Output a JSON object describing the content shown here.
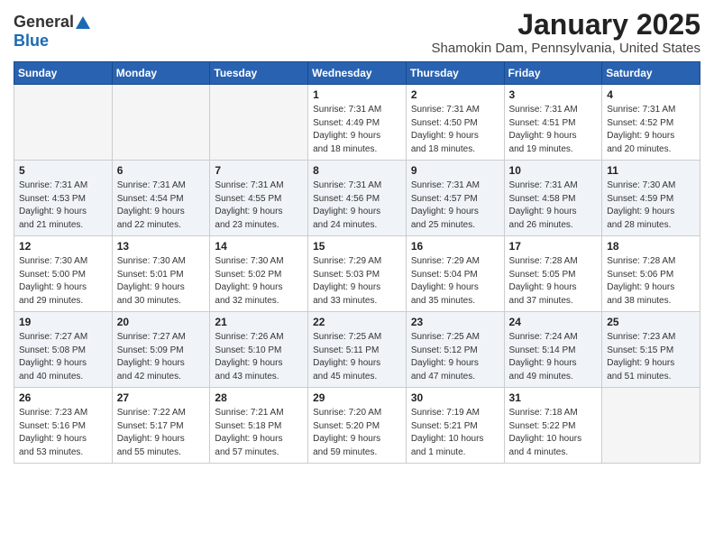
{
  "header": {
    "logo_general": "General",
    "logo_blue": "Blue",
    "month": "January 2025",
    "location": "Shamokin Dam, Pennsylvania, United States"
  },
  "weekdays": [
    "Sunday",
    "Monday",
    "Tuesday",
    "Wednesday",
    "Thursday",
    "Friday",
    "Saturday"
  ],
  "weeks": [
    [
      {
        "day": "",
        "info": "",
        "empty": true
      },
      {
        "day": "",
        "info": "",
        "empty": true
      },
      {
        "day": "",
        "info": "",
        "empty": true
      },
      {
        "day": "1",
        "info": "Sunrise: 7:31 AM\nSunset: 4:49 PM\nDaylight: 9 hours\nand 18 minutes."
      },
      {
        "day": "2",
        "info": "Sunrise: 7:31 AM\nSunset: 4:50 PM\nDaylight: 9 hours\nand 18 minutes."
      },
      {
        "day": "3",
        "info": "Sunrise: 7:31 AM\nSunset: 4:51 PM\nDaylight: 9 hours\nand 19 minutes."
      },
      {
        "day": "4",
        "info": "Sunrise: 7:31 AM\nSunset: 4:52 PM\nDaylight: 9 hours\nand 20 minutes."
      }
    ],
    [
      {
        "day": "5",
        "info": "Sunrise: 7:31 AM\nSunset: 4:53 PM\nDaylight: 9 hours\nand 21 minutes."
      },
      {
        "day": "6",
        "info": "Sunrise: 7:31 AM\nSunset: 4:54 PM\nDaylight: 9 hours\nand 22 minutes."
      },
      {
        "day": "7",
        "info": "Sunrise: 7:31 AM\nSunset: 4:55 PM\nDaylight: 9 hours\nand 23 minutes."
      },
      {
        "day": "8",
        "info": "Sunrise: 7:31 AM\nSunset: 4:56 PM\nDaylight: 9 hours\nand 24 minutes."
      },
      {
        "day": "9",
        "info": "Sunrise: 7:31 AM\nSunset: 4:57 PM\nDaylight: 9 hours\nand 25 minutes."
      },
      {
        "day": "10",
        "info": "Sunrise: 7:31 AM\nSunset: 4:58 PM\nDaylight: 9 hours\nand 26 minutes."
      },
      {
        "day": "11",
        "info": "Sunrise: 7:30 AM\nSunset: 4:59 PM\nDaylight: 9 hours\nand 28 minutes."
      }
    ],
    [
      {
        "day": "12",
        "info": "Sunrise: 7:30 AM\nSunset: 5:00 PM\nDaylight: 9 hours\nand 29 minutes."
      },
      {
        "day": "13",
        "info": "Sunrise: 7:30 AM\nSunset: 5:01 PM\nDaylight: 9 hours\nand 30 minutes."
      },
      {
        "day": "14",
        "info": "Sunrise: 7:30 AM\nSunset: 5:02 PM\nDaylight: 9 hours\nand 32 minutes."
      },
      {
        "day": "15",
        "info": "Sunrise: 7:29 AM\nSunset: 5:03 PM\nDaylight: 9 hours\nand 33 minutes."
      },
      {
        "day": "16",
        "info": "Sunrise: 7:29 AM\nSunset: 5:04 PM\nDaylight: 9 hours\nand 35 minutes."
      },
      {
        "day": "17",
        "info": "Sunrise: 7:28 AM\nSunset: 5:05 PM\nDaylight: 9 hours\nand 37 minutes."
      },
      {
        "day": "18",
        "info": "Sunrise: 7:28 AM\nSunset: 5:06 PM\nDaylight: 9 hours\nand 38 minutes."
      }
    ],
    [
      {
        "day": "19",
        "info": "Sunrise: 7:27 AM\nSunset: 5:08 PM\nDaylight: 9 hours\nand 40 minutes."
      },
      {
        "day": "20",
        "info": "Sunrise: 7:27 AM\nSunset: 5:09 PM\nDaylight: 9 hours\nand 42 minutes."
      },
      {
        "day": "21",
        "info": "Sunrise: 7:26 AM\nSunset: 5:10 PM\nDaylight: 9 hours\nand 43 minutes."
      },
      {
        "day": "22",
        "info": "Sunrise: 7:25 AM\nSunset: 5:11 PM\nDaylight: 9 hours\nand 45 minutes."
      },
      {
        "day": "23",
        "info": "Sunrise: 7:25 AM\nSunset: 5:12 PM\nDaylight: 9 hours\nand 47 minutes."
      },
      {
        "day": "24",
        "info": "Sunrise: 7:24 AM\nSunset: 5:14 PM\nDaylight: 9 hours\nand 49 minutes."
      },
      {
        "day": "25",
        "info": "Sunrise: 7:23 AM\nSunset: 5:15 PM\nDaylight: 9 hours\nand 51 minutes."
      }
    ],
    [
      {
        "day": "26",
        "info": "Sunrise: 7:23 AM\nSunset: 5:16 PM\nDaylight: 9 hours\nand 53 minutes."
      },
      {
        "day": "27",
        "info": "Sunrise: 7:22 AM\nSunset: 5:17 PM\nDaylight: 9 hours\nand 55 minutes."
      },
      {
        "day": "28",
        "info": "Sunrise: 7:21 AM\nSunset: 5:18 PM\nDaylight: 9 hours\nand 57 minutes."
      },
      {
        "day": "29",
        "info": "Sunrise: 7:20 AM\nSunset: 5:20 PM\nDaylight: 9 hours\nand 59 minutes."
      },
      {
        "day": "30",
        "info": "Sunrise: 7:19 AM\nSunset: 5:21 PM\nDaylight: 10 hours\nand 1 minute."
      },
      {
        "day": "31",
        "info": "Sunrise: 7:18 AM\nSunset: 5:22 PM\nDaylight: 10 hours\nand 4 minutes."
      },
      {
        "day": "",
        "info": "",
        "empty": true
      }
    ]
  ]
}
